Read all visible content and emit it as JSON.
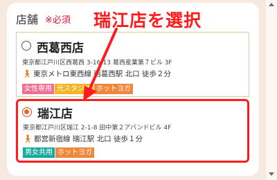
{
  "form": {
    "label": "店舗",
    "required": "※必須"
  },
  "annotation": {
    "text": "瑞江店を選択",
    "color": "#ff1b1b"
  },
  "stores": [
    {
      "name": "西葛西店",
      "selected": false,
      "address": "東京都江戸川区西葛西 3-16-13 葛西産業第７ビル 3F",
      "access_icon": "walking-person-icon",
      "access": "東京メトロ東西線 西葛西駅 北口 徒歩２分",
      "tags": [
        {
          "label": "女性専用",
          "color": "#ee6f8f"
        },
        {
          "label": "光スタジオ",
          "color": "#f6b422"
        },
        {
          "label": "ホットヨガ",
          "color": "#f0873a"
        }
      ]
    },
    {
      "name": "瑞江店",
      "selected": true,
      "address": "東京都江戸川区瑞江 2-1-8 田中第２アバンドビル 4F",
      "access_icon": "walking-person-icon",
      "access": "都営新宿線 瑞江駅 北口 徒歩１分",
      "tags": [
        {
          "label": "男女共用",
          "color": "#1aa9a1"
        },
        {
          "label": "ホットヨガ",
          "color": "#f0873a"
        }
      ]
    }
  ]
}
